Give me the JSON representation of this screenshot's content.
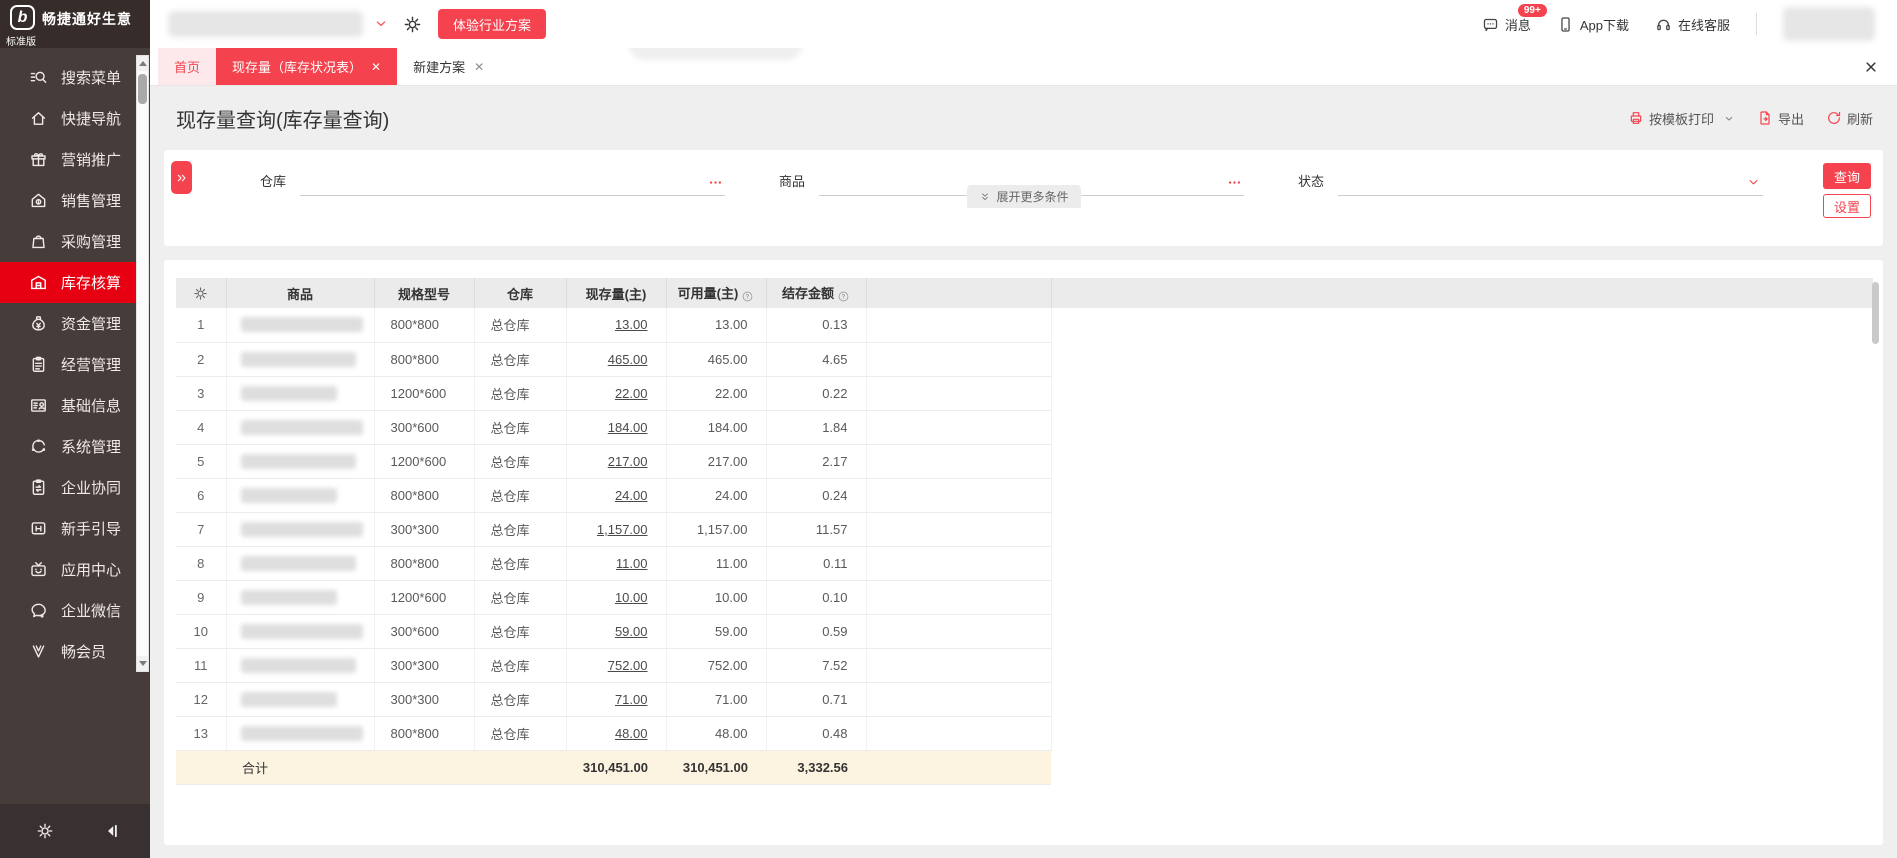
{
  "app": {
    "brand": "畅捷通好生意",
    "edition": "标准版",
    "logo_glyph": "b",
    "experience_button": "体验行业方案"
  },
  "topbar": {
    "messages_label": "消息",
    "messages_badge": "99+",
    "app_download_label": "App下载",
    "online_service_label": "在线客服"
  },
  "tabs": [
    {
      "label": "首页",
      "closable": false
    },
    {
      "label": "现存量（库存状况表）",
      "closable": true,
      "active": true
    },
    {
      "label": "新建方案",
      "closable": true
    }
  ],
  "page": {
    "title": "现存量查询(库存量查询)",
    "tools": {
      "print": "按模板打印",
      "export": "导出",
      "refresh": "刷新"
    }
  },
  "filters": {
    "warehouse_label": "仓库",
    "product_label": "商品",
    "status_label": "状态",
    "expand_more": "展开更多条件",
    "query_button": "查询",
    "settings_button": "设置"
  },
  "sidebar": {
    "items": [
      {
        "label": "搜索菜单",
        "icon": "search-icon"
      },
      {
        "label": "快捷导航",
        "icon": "home-icon"
      },
      {
        "label": "营销推广",
        "icon": "gift-icon"
      },
      {
        "label": "销售管理",
        "icon": "sales-icon"
      },
      {
        "label": "采购管理",
        "icon": "bag-icon"
      },
      {
        "label": "库存核算",
        "icon": "warehouse-icon",
        "active": true
      },
      {
        "label": "资金管理",
        "icon": "money-icon"
      },
      {
        "label": "经营管理",
        "icon": "clipboard-icon"
      },
      {
        "label": "基础信息",
        "icon": "idcard-icon"
      },
      {
        "label": "系统管理",
        "icon": "system-icon"
      },
      {
        "label": "企业协同",
        "icon": "collab-icon"
      },
      {
        "label": "新手引导",
        "icon": "guide-icon"
      },
      {
        "label": "应用中心",
        "icon": "tv-icon"
      },
      {
        "label": "企业微信",
        "icon": "wechat-icon"
      },
      {
        "label": "畅会员",
        "icon": "member-icon"
      }
    ]
  },
  "table": {
    "columns": [
      "商品",
      "规格型号",
      "仓库",
      "现存量(主)",
      "可用量(主)",
      "结存金额"
    ],
    "rows": [
      {
        "no": "1",
        "spec": "800*800",
        "warehouse": "总仓库",
        "qty": "13.00",
        "available": "13.00",
        "amount": "0.13"
      },
      {
        "no": "2",
        "spec": "800*800",
        "warehouse": "总仓库",
        "qty": "465.00",
        "available": "465.00",
        "amount": "4.65"
      },
      {
        "no": "3",
        "spec": "1200*600",
        "warehouse": "总仓库",
        "qty": "22.00",
        "available": "22.00",
        "amount": "0.22"
      },
      {
        "no": "4",
        "spec": "300*600",
        "warehouse": "总仓库",
        "qty": "184.00",
        "available": "184.00",
        "amount": "1.84"
      },
      {
        "no": "5",
        "spec": "1200*600",
        "warehouse": "总仓库",
        "qty": "217.00",
        "available": "217.00",
        "amount": "2.17"
      },
      {
        "no": "6",
        "spec": "800*800",
        "warehouse": "总仓库",
        "qty": "24.00",
        "available": "24.00",
        "amount": "0.24"
      },
      {
        "no": "7",
        "spec": "300*300",
        "warehouse": "总仓库",
        "qty": "1,157.00",
        "available": "1,157.00",
        "amount": "11.57"
      },
      {
        "no": "8",
        "spec": "800*800",
        "warehouse": "总仓库",
        "qty": "11.00",
        "available": "11.00",
        "amount": "0.11"
      },
      {
        "no": "9",
        "spec": "1200*600",
        "warehouse": "总仓库",
        "qty": "10.00",
        "available": "10.00",
        "amount": "0.10"
      },
      {
        "no": "10",
        "spec": "300*600",
        "warehouse": "总仓库",
        "qty": "59.00",
        "available": "59.00",
        "amount": "0.59"
      },
      {
        "no": "11",
        "spec": "300*300",
        "warehouse": "总仓库",
        "qty": "752.00",
        "available": "752.00",
        "amount": "7.52"
      },
      {
        "no": "12",
        "spec": "300*300",
        "warehouse": "总仓库",
        "qty": "71.00",
        "available": "71.00",
        "amount": "0.71"
      },
      {
        "no": "13",
        "spec": "800*800",
        "warehouse": "总仓库",
        "qty": "48.00",
        "available": "48.00",
        "amount": "0.48"
      }
    ],
    "total_label": "合计",
    "totals": {
      "qty": "310,451.00",
      "available": "310,451.00",
      "amount": "3,332.56"
    }
  },
  "colors": {
    "accent_red": "#f4434f",
    "sidebar_active_red": "#e60012",
    "totals_row_bg": "#fcf3e0",
    "sidebar_bg": "#463c3a"
  }
}
